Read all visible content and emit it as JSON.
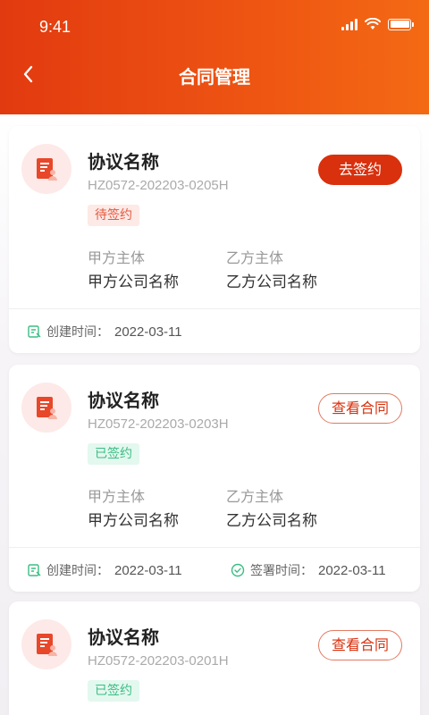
{
  "status_bar": {
    "time": "9:41"
  },
  "nav": {
    "title": "合同管理"
  },
  "colors": {
    "brand": "#e23a10",
    "pending": "#e55a3f",
    "signed": "#3bbd84"
  },
  "contracts": [
    {
      "name": "协议名称",
      "code": "HZ0572-202203-0205H",
      "status": "待签约",
      "action": "去签约",
      "party_a_label": "甲方主体",
      "party_a_value": "甲方公司名称",
      "party_b_label": "乙方主体",
      "party_b_value": "乙方公司名称",
      "created_label": "创建时间：",
      "created_value": "2022-03-11"
    },
    {
      "name": "协议名称",
      "code": "HZ0572-202203-0203H",
      "status": "已签约",
      "action": "查看合同",
      "party_a_label": "甲方主体",
      "party_a_value": "甲方公司名称",
      "party_b_label": "乙方主体",
      "party_b_value": "乙方公司名称",
      "created_label": "创建时间：",
      "created_value": "2022-03-11",
      "signed_label": "签署时间：",
      "signed_value": "2022-03-11"
    },
    {
      "name": "协议名称",
      "code": "HZ0572-202203-0201H",
      "status": "已签约",
      "action": "查看合同"
    }
  ]
}
